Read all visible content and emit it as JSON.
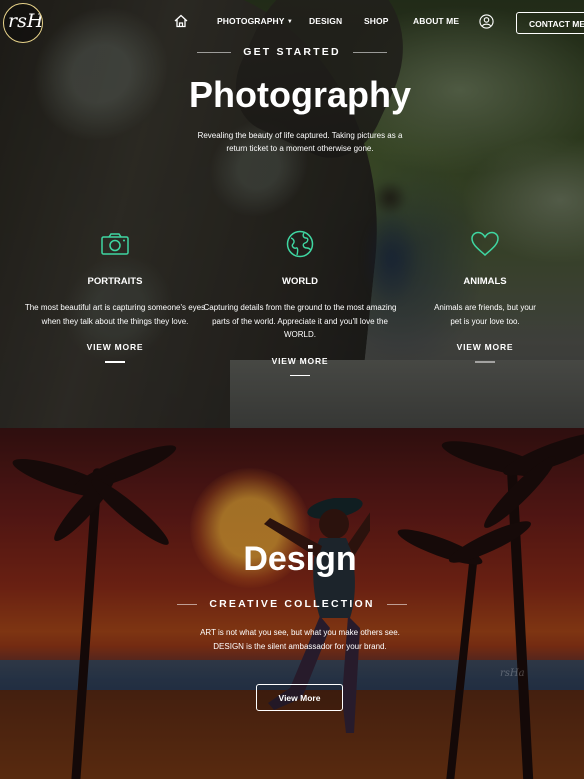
{
  "brand": {
    "logo_text": "rsHa"
  },
  "nav": {
    "items": [
      {
        "label": "PHOTOGRAPHY",
        "has_dropdown": true
      },
      {
        "label": "DESIGN"
      },
      {
        "label": "SHOP"
      },
      {
        "label": "ABOUT ME"
      }
    ],
    "contact_label": "CONTACT ME",
    "icons": [
      "home-icon",
      "user-icon"
    ]
  },
  "hero": {
    "eyebrow": "GET STARTED",
    "title": "Photography",
    "description": "Revealing the beauty of life captured. Taking pictures as a return ticket to a moment otherwise gone.",
    "features": [
      {
        "icon": "camera-icon",
        "title": "PORTRAITS",
        "description": "The most beautiful art is capturing someone's eyes when they talk about the things they love.",
        "link": "VIEW MORE"
      },
      {
        "icon": "globe-icon",
        "title": "WORLD",
        "description": "Capturing details from the ground to the most amazing parts of the world. Appreciate it and you'll love the WORLD.",
        "link": "VIEW MORE"
      },
      {
        "icon": "heart-icon",
        "title": "ANIMALS",
        "description": "Animals are friends, but your pet is your love too.",
        "link": "VIEW MORE"
      }
    ],
    "accent_color": "#3fd6a1"
  },
  "design": {
    "title": "Design",
    "eyebrow": "CREATIVE COLLECTION",
    "description_line1": "ART is not what you see, but what you make others see.",
    "description_line2": "DESIGN is the silent ambassador for your brand.",
    "button_label": "View More",
    "watermark": "rsHa"
  }
}
